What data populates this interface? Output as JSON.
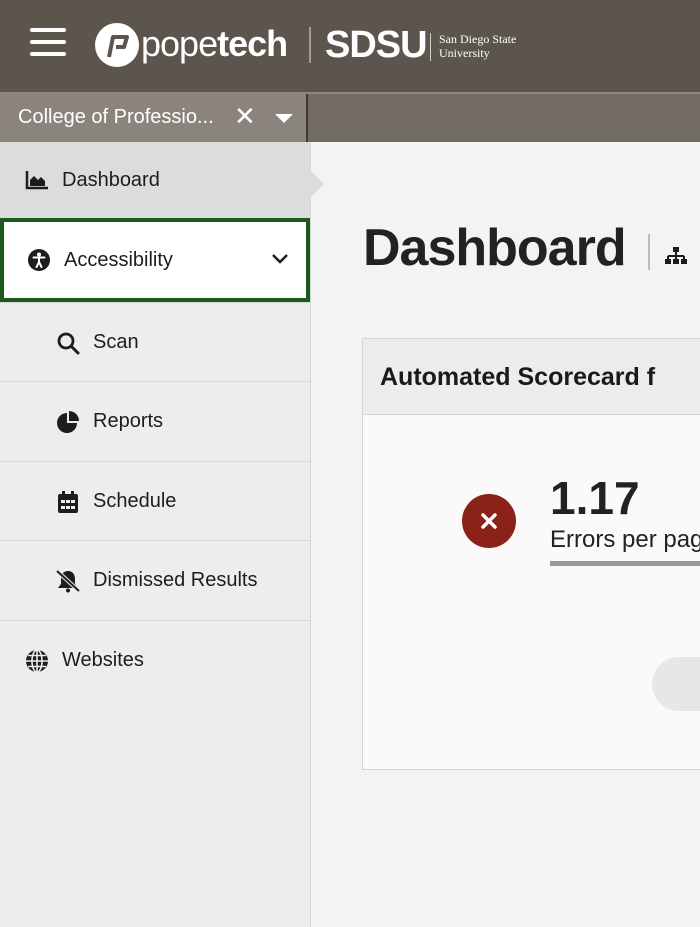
{
  "header": {
    "logo_text_light": "pope",
    "logo_text_bold": "tech",
    "org_short": "SDSU",
    "org_full_line1": "San Diego State",
    "org_full_line2": "University"
  },
  "group_select": {
    "selected": "College of Professio...",
    "clear_glyph": "✕"
  },
  "sidebar": {
    "dashboard": "Dashboard",
    "accessibility": "Accessibility",
    "sub_items": [
      {
        "label": "Scan",
        "icon": "search-icon"
      },
      {
        "label": "Reports",
        "icon": "pie-chart-icon"
      },
      {
        "label": "Schedule",
        "icon": "calendar-icon"
      },
      {
        "label": "Dismissed Results",
        "icon": "bell-slash-icon"
      }
    ],
    "websites": "Websites"
  },
  "main": {
    "title": "Dashboard",
    "card_title": "Automated Scorecard f",
    "errors_value": "1.17",
    "errors_label": "Errors per pag"
  },
  "colors": {
    "topbar": "#5c554d",
    "accent_green": "#1c5a1c",
    "error_red": "#8a2219"
  }
}
